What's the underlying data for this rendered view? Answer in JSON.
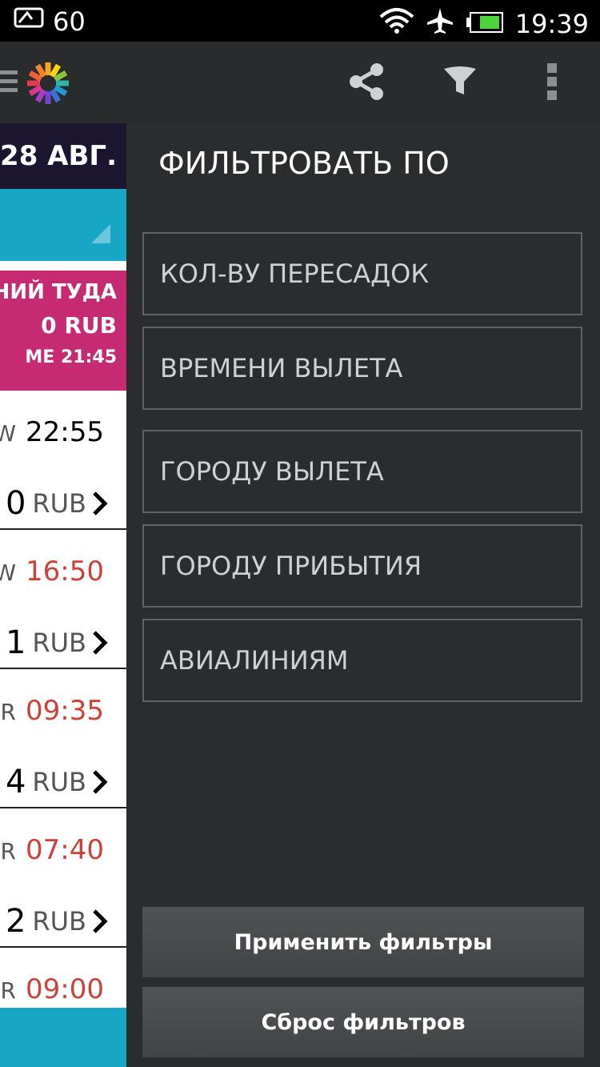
{
  "status_bar": {
    "battery_text": "60",
    "clock": "19:39",
    "icons": [
      "message-icon",
      "wifi-icon",
      "airplane-mode-icon",
      "battery-icon"
    ]
  },
  "action_bar": {
    "icons": [
      "menu-icon",
      "app-logo",
      "share-icon",
      "filter-icon",
      "overflow-menu-icon"
    ]
  },
  "left_panel": {
    "date": "28 АВГ.",
    "highlight": {
      "line1": "ДНИЙ ТУДА",
      "line2": "0 RUB",
      "line3": "МЕ 21:45"
    },
    "flights": [
      {
        "code": "W",
        "time": "22:55",
        "time_red": false,
        "price_digit": "0",
        "currency": "RUB"
      },
      {
        "code": "W",
        "time": "16:50",
        "time_red": true,
        "price_digit": "1",
        "currency": "RUB"
      },
      {
        "code": "R",
        "time": "09:35",
        "time_red": true,
        "price_digit": "4",
        "currency": "RUB"
      },
      {
        "code": "R",
        "time": "07:40",
        "time_red": true,
        "price_digit": "2",
        "currency": "RUB"
      },
      {
        "code": "R",
        "time": "09:00",
        "time_red": true
      }
    ]
  },
  "drawer": {
    "title": "ФИЛЬТРОВАТЬ ПО",
    "filters": [
      {
        "label": "КОЛ-ВУ ПЕРЕСАДОК"
      },
      {
        "label": "ВРЕМЕНИ ВЫЛЕТА"
      },
      {
        "label": "ГОРОДУ ВЫЛЕТА"
      },
      {
        "label": "ГОРОДУ ПРИБЫТИЯ"
      },
      {
        "label": "АВИАЛИНИЯМ"
      }
    ],
    "apply_button": "Применить фильтры",
    "reset_button": "Сброс фильтров"
  },
  "colors": {
    "drawer_bg": "#2b2c2e",
    "accent_teal": "#17a6c5",
    "accent_pink": "#c52a73",
    "time_red": "#d0403a"
  }
}
